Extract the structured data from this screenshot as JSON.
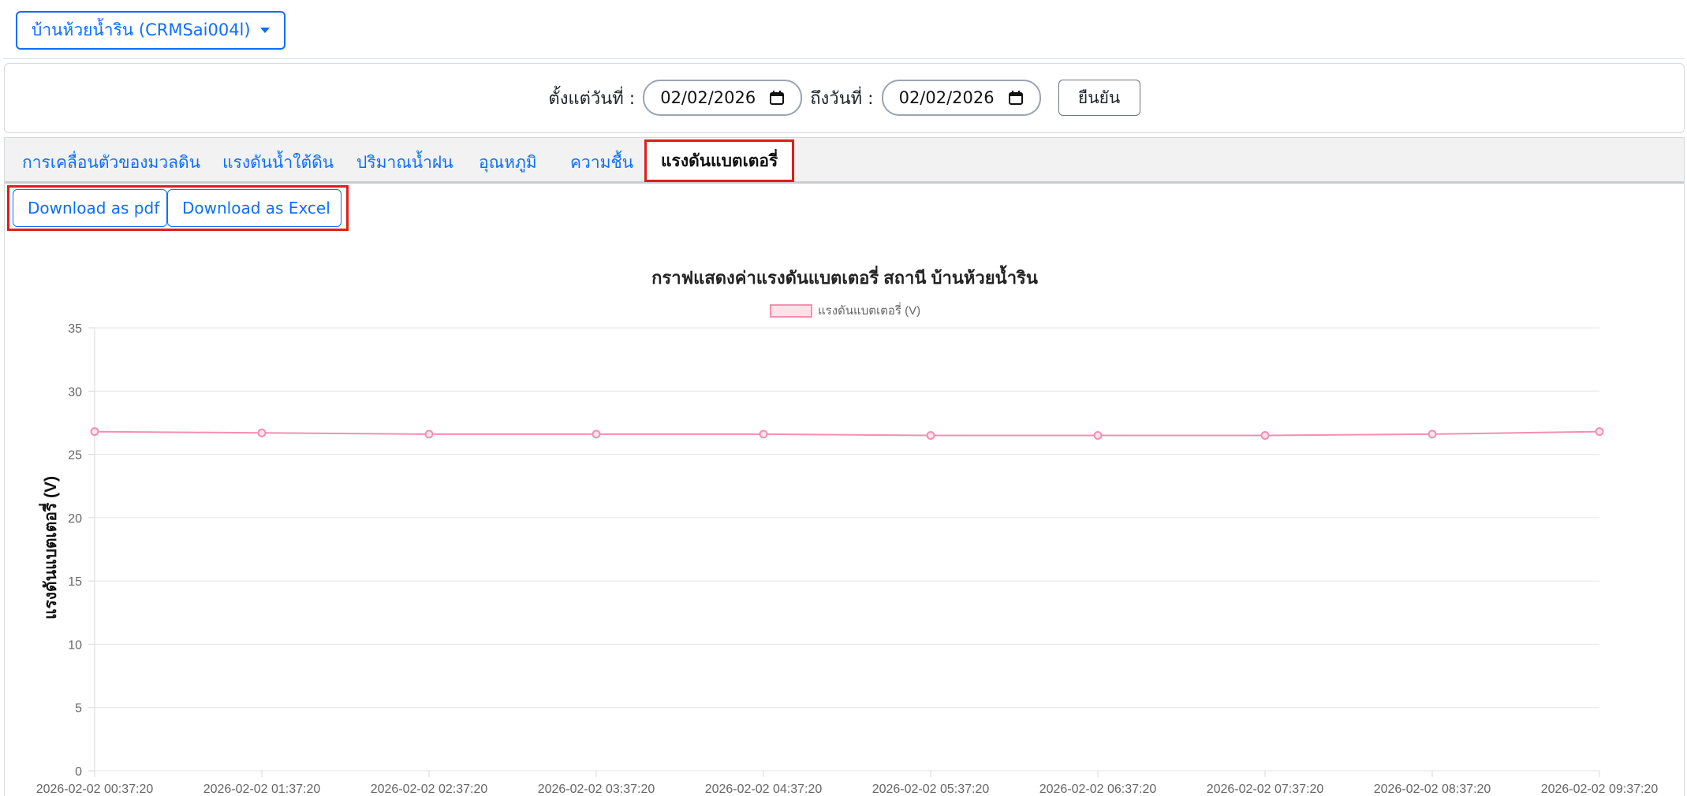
{
  "station": {
    "label": "บ้านห้วยน้ำริน (CRMSai004l)"
  },
  "date_filter": {
    "from_label": "ตั้งแต่วันที่ :",
    "from_value": "02/02/2026",
    "to_label": "ถึงวันที่ :",
    "to_value": "02/02/2026",
    "confirm_label": "ยืนยัน"
  },
  "tabs": [
    {
      "label": "การเคลื่อนตัวของมวลดิน"
    },
    {
      "label": "แรงดันน้ำใต้ดิน"
    },
    {
      "label": "ปริมาณน้ำฝน"
    },
    {
      "label": "อุณหภูมิ"
    },
    {
      "label": "ความชื้น"
    },
    {
      "label": "แรงดันแบตเตอรี่",
      "active": true
    }
  ],
  "downloads": {
    "pdf_label": "Download as pdf",
    "excel_label": "Download as Excel"
  },
  "colors": {
    "accent": "#0d6efd",
    "highlight": "#e31b1b",
    "series_line": "#f48fb1",
    "series_fill": "#fde2ea"
  },
  "chart_data": {
    "type": "line",
    "title": "กราฟแสดงค่าแรงดันแบตเตอรี่ สถานี บ้านห้วยน้ำริน",
    "xlabel": "",
    "ylabel": "แรงดันแบตเตอรี่ (V)",
    "ylim": [
      0,
      35
    ],
    "yticks": [
      0,
      5,
      10,
      15,
      20,
      25,
      30,
      35
    ],
    "grid": true,
    "legend_position": "top-center",
    "x": [
      "2026-02-02 00:37:20",
      "2026-02-02 01:37:20",
      "2026-02-02 02:37:20",
      "2026-02-02 03:37:20",
      "2026-02-02 04:37:20",
      "2026-02-02 05:37:20",
      "2026-02-02 06:37:20",
      "2026-02-02 07:37:20",
      "2026-02-02 08:37:20",
      "2026-02-02 09:37:20"
    ],
    "series": [
      {
        "name": "แรงดันแบตเตอรี่ (V)",
        "values": [
          26.8,
          26.7,
          26.6,
          26.6,
          26.6,
          26.5,
          26.5,
          26.5,
          26.6,
          26.8
        ]
      }
    ]
  }
}
